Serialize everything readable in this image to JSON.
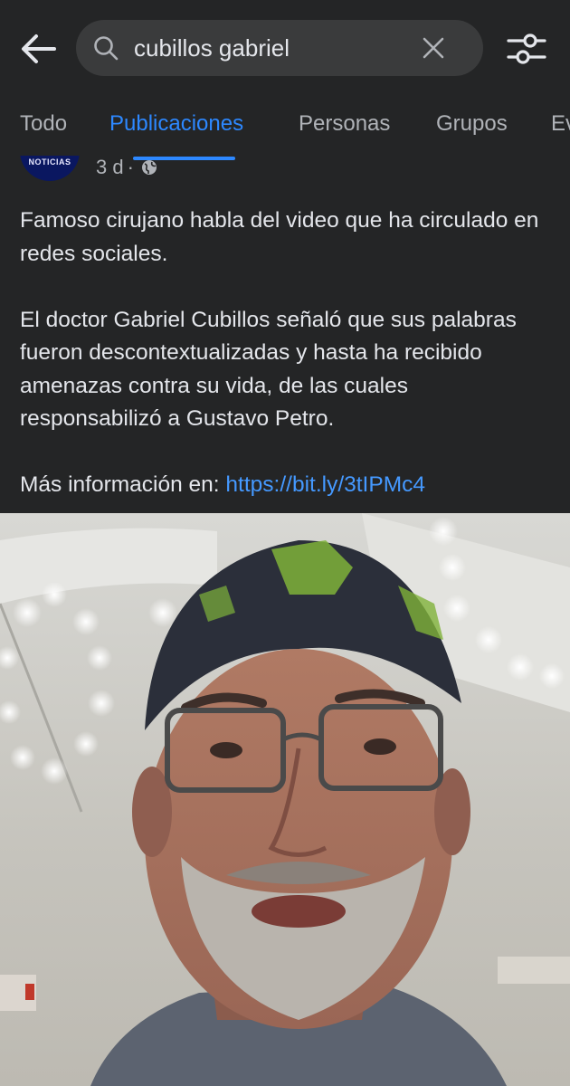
{
  "search": {
    "query": "cubillos gabriel"
  },
  "tabs": [
    {
      "label": "Todo",
      "active": false
    },
    {
      "label": "Publicaciones",
      "active": true
    },
    {
      "label": "Personas",
      "active": false
    },
    {
      "label": "Grupos",
      "active": false
    },
    {
      "label": "Ev",
      "active": false
    }
  ],
  "post": {
    "author_avatar_text": "NOTICIAS",
    "time": "3 d",
    "separator": "·",
    "privacy_icon": "globe-icon",
    "paragraph1": "Famoso cirujano habla del video que ha circulado en redes sociales.",
    "paragraph2": "El doctor Gabriel Cubillos señaló que sus palabras fueron descontextualizadas y hasta ha recibido amenazas contra su vida, de las cuales responsabilizó a Gustavo Petro.",
    "more_info_label": "Más información en: ",
    "link": "https://bit.ly/3tIPMc4"
  },
  "colors": {
    "background": "#242526",
    "accent": "#2d88ff",
    "link": "#4599ff",
    "search_bg": "#3a3b3c"
  }
}
